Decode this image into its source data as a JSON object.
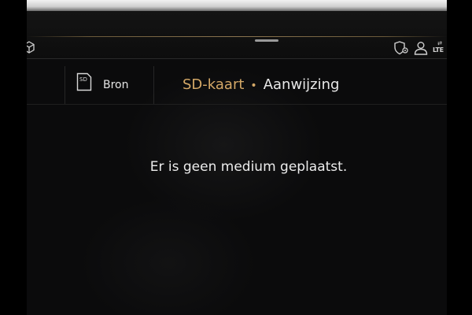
{
  "status": {
    "icons": [
      "cube-icon",
      "shield-location-icon",
      "user-icon",
      "lte-signal-icon"
    ],
    "lte_label": "LTE",
    "lte_arrows": "⇄"
  },
  "source": {
    "icon_text": "SD",
    "label": "Bron"
  },
  "breadcrumb": {
    "active": "SD-kaart",
    "separator": "•",
    "current": "Aanwijzing"
  },
  "message": "Er is geen medium geplaatst.",
  "colors": {
    "accent": "#d4a867",
    "text": "#e8e8e8",
    "background": "#0b0b0c"
  }
}
